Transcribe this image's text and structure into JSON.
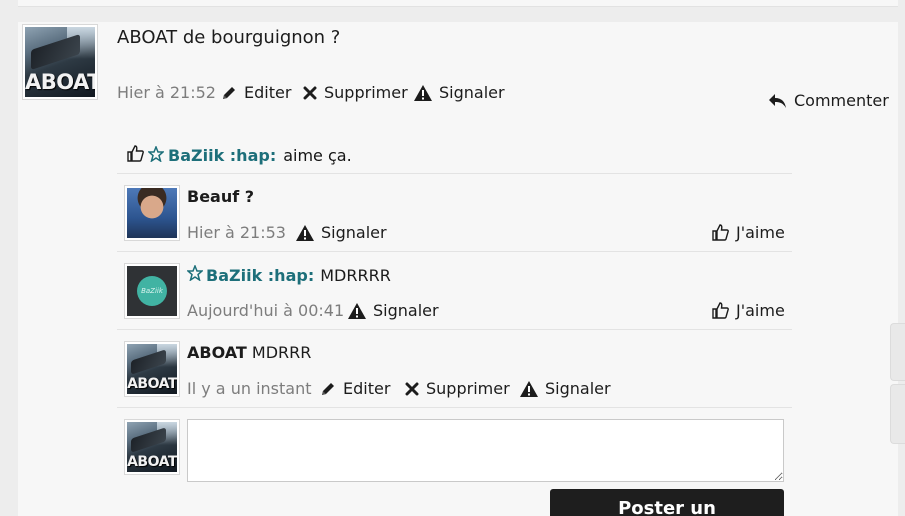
{
  "post": {
    "title": "ABOAT de bourguignon ?",
    "avatar_label": "ABOAT",
    "timestamp": "Hier à 21:52",
    "edit_label": "Editer",
    "delete_label": "Supprimer",
    "report_label": "Signaler",
    "comment_label": "Commenter"
  },
  "likes": {
    "user": "BaZiik :hap:",
    "text": "aime ça."
  },
  "comments": [
    {
      "author": "",
      "text": "Beauf ?",
      "timestamp": "Hier à 21:53",
      "report_label": "Signaler",
      "like_label": "J'aime"
    },
    {
      "author": "BaZiik :hap:",
      "text": "MDRRRR",
      "avatar_label": "BaZiik",
      "timestamp": "Aujourd'hui à 00:41",
      "report_label": "Signaler",
      "like_label": "J'aime"
    },
    {
      "author": "ABOAT",
      "text": "MDRRR",
      "avatar_label": "ABOAT",
      "timestamp": "Il y a un instant",
      "edit_label": "Editer",
      "delete_label": "Supprimer",
      "report_label": "Signaler"
    }
  ],
  "composer": {
    "avatar_label": "ABOAT",
    "placeholder": "",
    "submit_label": "Poster un commentaire"
  },
  "colors": {
    "link": "#1d6f7a",
    "button_bg": "#1e1e1e",
    "muted": "#7d7d7d"
  }
}
